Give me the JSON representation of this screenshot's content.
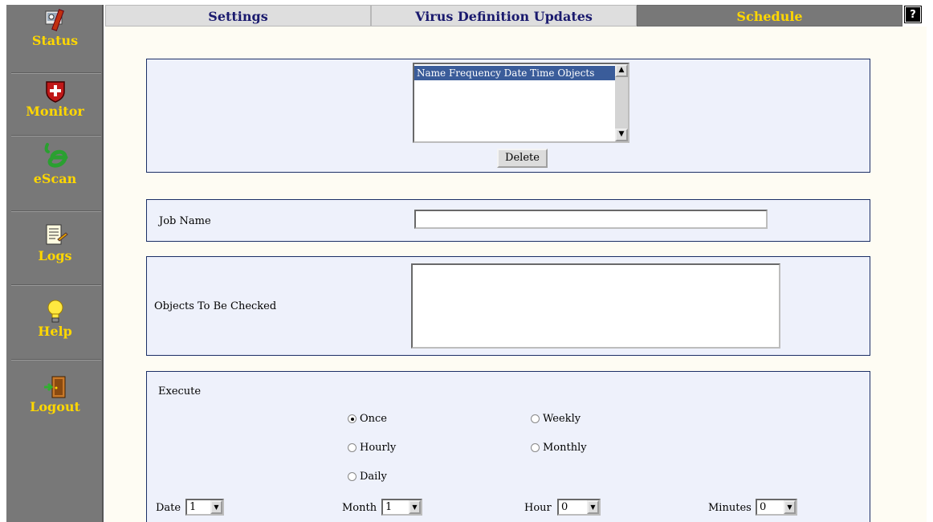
{
  "sidebar": {
    "items": [
      {
        "label": "Status",
        "icon": "tools-icon"
      },
      {
        "label": "Monitor",
        "icon": "shield-icon"
      },
      {
        "label": "eScan",
        "icon": "escan-logo-icon"
      },
      {
        "label": "Logs",
        "icon": "log-document-icon"
      },
      {
        "label": "Help",
        "icon": "lightbulb-icon"
      },
      {
        "label": "Logout",
        "icon": "exit-door-icon"
      }
    ]
  },
  "tabs": {
    "settings": "Settings",
    "virus_updates": "Virus Definition Updates",
    "schedule": "Schedule",
    "help": "?"
  },
  "jobs_list": {
    "header": "Name Frequency Date Time Objects",
    "delete_label": "Delete"
  },
  "job_name": {
    "label": "Job Name",
    "value": ""
  },
  "objects": {
    "label": "Objects To Be Checked",
    "value": ""
  },
  "execute": {
    "label": "Execute",
    "options": {
      "once": "Once",
      "hourly": "Hourly",
      "daily": "Daily",
      "weekly": "Weekly",
      "monthly": "Monthly"
    },
    "selected": "Once"
  },
  "datetime": {
    "date_label": "Date",
    "date_value": "1",
    "month_label": "Month",
    "month_value": "1",
    "hour_label": "Hour",
    "hour_value": "0",
    "minutes_label": "Minutes",
    "minutes_value": "0"
  },
  "colors": {
    "sidebar_bg": "#787878",
    "accent_gold": "#ffd700",
    "tab_text": "#1a1a6e",
    "panel_bg": "#eef1fb",
    "panel_border": "#1c2f66",
    "list_header_bg": "#3a5c9a"
  }
}
